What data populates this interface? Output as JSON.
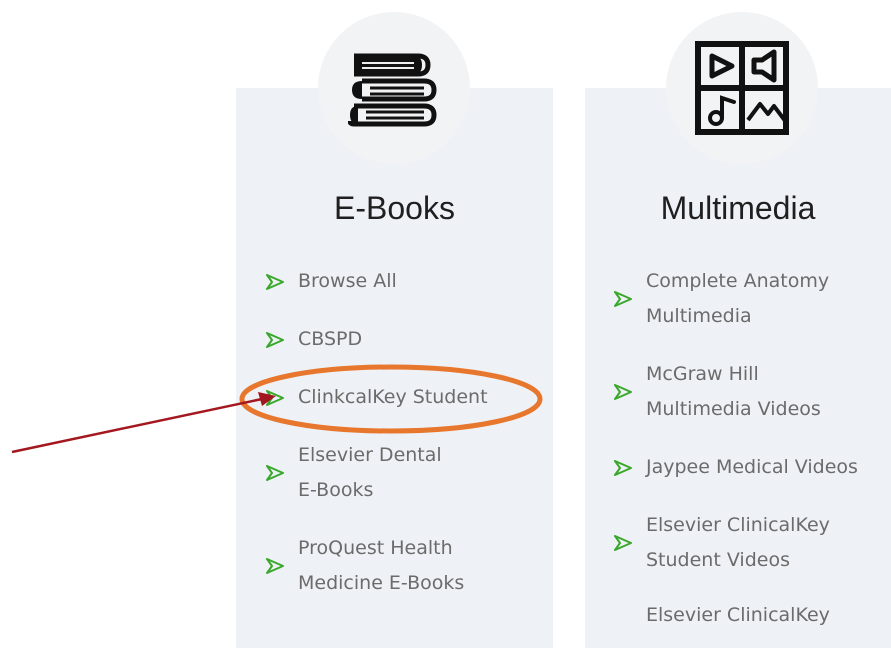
{
  "ebooks": {
    "title": "E-Books",
    "icon": "books-stack-icon",
    "items": [
      {
        "lines": [
          "Browse All",
          ""
        ]
      },
      {
        "lines": [
          "CBSPD",
          ""
        ]
      },
      {
        "lines": [
          "ClinkcalKey Student",
          ""
        ]
      },
      {
        "lines": [
          "Elsevier Dental",
          "E-Books"
        ]
      },
      {
        "lines": [
          "ProQuest Health",
          "Medicine E-Books"
        ]
      }
    ]
  },
  "multimedia": {
    "title": "Multimedia",
    "icon": "multimedia-grid-icon",
    "items": [
      {
        "lines": [
          "Complete Anatomy",
          "Multimedia"
        ]
      },
      {
        "lines": [
          "McGraw Hill",
          "Multimedia Videos"
        ]
      },
      {
        "lines": [
          "Jaypee Medical Videos",
          ""
        ]
      },
      {
        "lines": [
          "Elsevier ClinicalKey",
          "Student Videos"
        ]
      },
      {
        "lines": [
          "Elsevier ClinicalKey",
          ""
        ]
      }
    ]
  },
  "colors": {
    "card_bg": "#eef2f7",
    "arrow_bullet": "#3aa82a",
    "annotation_ellipse": "#e8772e",
    "annotation_arrow": "#a3171f",
    "link_text": "#6b6b6b"
  }
}
